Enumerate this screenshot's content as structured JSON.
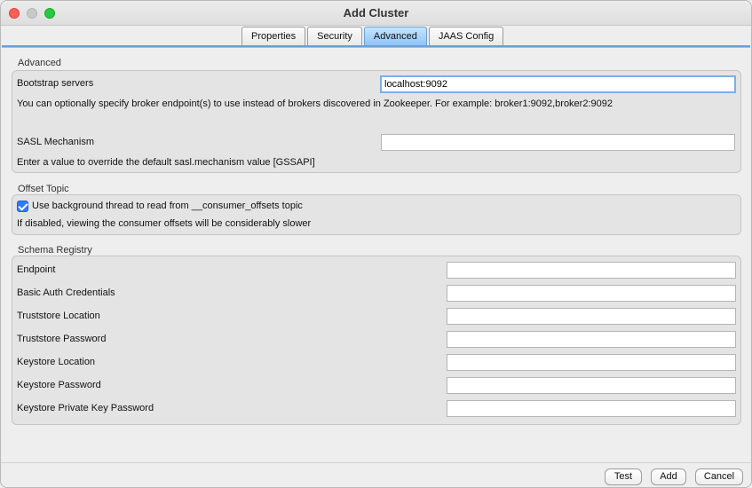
{
  "window": {
    "title": "Add Cluster"
  },
  "tabs": [
    {
      "label": "Properties"
    },
    {
      "label": "Security"
    },
    {
      "label": "Advanced"
    },
    {
      "label": "JAAS Config"
    }
  ],
  "advanced": {
    "section_label": "Advanced",
    "bootstrap_label": "Bootstrap servers",
    "bootstrap_value": "localhost:9092",
    "bootstrap_help": "You can optionally specify broker endpoint(s) to use instead of brokers discovered in Zookeeper. For example: broker1:9092,broker2:9092",
    "sasl_label": "SASL Mechanism",
    "sasl_value": "",
    "sasl_help": "Enter a value to override the default sasl.mechanism value [GSSAPI]"
  },
  "offset": {
    "section_label": "Offset Topic",
    "checkbox_label": "Use background thread to read from __consumer_offsets topic",
    "checked": true,
    "help": "If disabled, viewing the consumer offsets will be considerably slower"
  },
  "schema": {
    "section_label": "Schema Registry",
    "fields": [
      {
        "label": "Endpoint",
        "value": ""
      },
      {
        "label": "Basic Auth Credentials",
        "value": ""
      },
      {
        "label": "Truststore Location",
        "value": ""
      },
      {
        "label": "Truststore Password",
        "value": ""
      },
      {
        "label": "Keystore Location",
        "value": ""
      },
      {
        "label": "Keystore Password",
        "value": ""
      },
      {
        "label": "Keystore Private Key Password",
        "value": ""
      }
    ]
  },
  "buttons": {
    "test": "Test",
    "add": "Add",
    "cancel": "Cancel"
  }
}
